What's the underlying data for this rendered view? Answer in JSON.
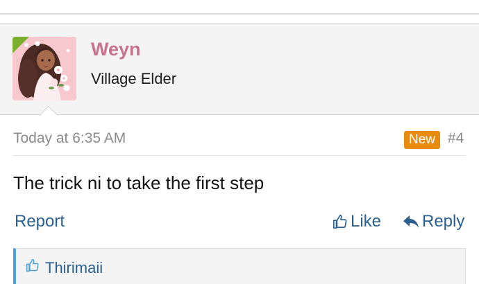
{
  "user": {
    "name": "Weyn",
    "title": "Village Elder"
  },
  "post": {
    "date": "Today at 6:35 AM",
    "badge": "New",
    "number": "#4",
    "body": "The trick ni to take the first step"
  },
  "actions": {
    "report": "Report",
    "like": "Like",
    "reply": "Reply"
  },
  "likes": {
    "users": "Thirimaii"
  },
  "colors": {
    "username": "#c8738e",
    "link": "#2a5f8f",
    "badge": "#e98b10",
    "likes_accent": "#4ba0d8",
    "online_indicator": "#7ab02c"
  },
  "icons": {
    "like": "thumbs-up-icon",
    "reply": "reply-arrow-icon",
    "likes": "thumbs-up-icon",
    "online": "online-indicator-icon"
  }
}
